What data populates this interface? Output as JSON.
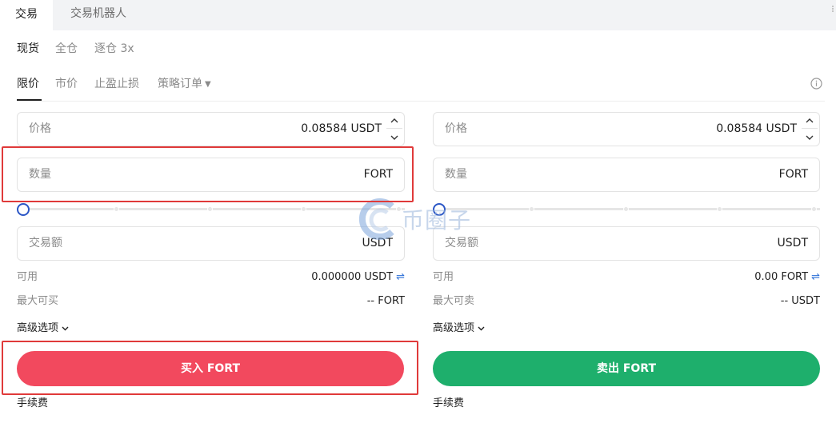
{
  "tabs": {
    "trade": "交易",
    "bot": "交易机器人"
  },
  "modes": [
    "现货",
    "全仓",
    "逐仓 3x"
  ],
  "order_types": {
    "limit": "限价",
    "market": "市价",
    "tpsl": "止盈止损",
    "strategy": "策略订单"
  },
  "buy": {
    "price_label": "价格",
    "price_value": "0.08584 USDT",
    "qty_label": "数量",
    "qty_unit": "FORT",
    "amount_label": "交易额",
    "amount_unit": "USDT",
    "available_label": "可用",
    "available_value": "0.000000 USDT",
    "max_label": "最大可买",
    "max_value": "-- FORT",
    "advanced_label": "高级选项",
    "button_label": "买入 FORT",
    "fee_label": "手续费",
    "slider_percent": 0
  },
  "sell": {
    "price_label": "价格",
    "price_value": "0.08584 USDT",
    "qty_label": "数量",
    "qty_unit": "FORT",
    "amount_label": "交易额",
    "amount_unit": "USDT",
    "available_label": "可用",
    "available_value": "0.00 FORT",
    "max_label": "最大可卖",
    "max_value": "-- USDT",
    "advanced_label": "高级选项",
    "button_label": "卖出 FORT",
    "fee_label": "手续费",
    "slider_percent": 0
  },
  "watermark": "币圈子",
  "colors": {
    "buy": "#f2495e",
    "sell": "#1eaf6c",
    "highlight": "#e03a3a",
    "accent": "#2b56c6"
  },
  "icons": {
    "info": "info-circle-icon",
    "swap": "swap-icon",
    "caret": "caret-down-icon",
    "chevron": "chevron-down-icon",
    "stepper_up": "chevron-up-icon",
    "stepper_down": "chevron-down-icon"
  }
}
